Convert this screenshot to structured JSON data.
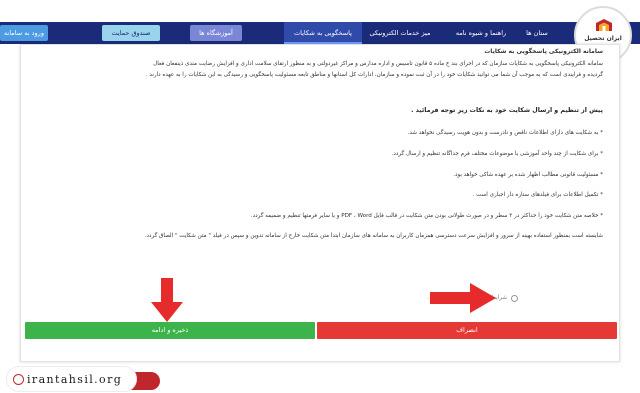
{
  "nav": {
    "items": [
      {
        "label": "ستان ها"
      },
      {
        "label": "راهنما و شیوه نامه"
      },
      {
        "label": "میز خدمات الکترونیکی"
      },
      {
        "label": "پاسخگویی به شکایات"
      }
    ],
    "buttons": {
      "training": "آموزشگاه ها",
      "support_fund": "صندوق حمایت",
      "login": "ورود به سامانه"
    }
  },
  "logo": {
    "text": "ایران تحصیل"
  },
  "content": {
    "title": "سامانه الکترونیکی پاسخگویی به شکایات",
    "intro_line1": "سامانه الکترونیکی پاسخگویی به شکایات سازمان که در اجرای بند خ ماده ۵ قانون تاسیس و اداره مدارس و مراکز غیردولتی و به منظور ارتقای سلامت اداری و افزایش رضایت مندی ذینفعان فعال",
    "intro_line2": "گردیده و فرایندی است که به موجب آن شما می توانید شکایات خود را در آن ثبت نموده و سازمان، ادارات کل استانها و مناطق تابعه مسئولیت پاسخگویی و رسیدگی به این شکایات را به عهده دارند .",
    "heading": "پیش از تنظیم و ارسال شکایت خود به نکات زیر توجه فرمائید .",
    "notes": [
      "* به شکایت های دارای اطلاعات ناقص و نادرست و بدون هویت رسیدگی نخواهد شد.",
      "* برای شکایت از چند واحد آموزشی یا موضوعات مختلف فرم جداگانه تنظیم و ارسال گردد.",
      "* مسئولیت قانونی مطالب اظهار شده بر عهده شاکی خواهد بود.",
      "* تکمیل اطلاعات برای فیلدهای ستاره دار اجباری است .",
      "* خلاصه متن شکایت خود را حداکثر در ۳ سطر و در صورت طولانی بودن متن شکایت در قالب فایل PDF ، Word و یا سایر فرمتها تنظیم و ضمیمه گردد.",
      "شایسته است بمنظور استفاده بهینه از سرور و افزایش سرعت دسترسی همزمان کاربران به سامانه های سازمان ابتدا متن شکایت خارج از سامانه تدوین و سپس در فیلد \" متن شکایت \" الصاق گردد."
    ],
    "agreement_label": "شرایط و راهنما را مطالعه نمودم ."
  },
  "actions": {
    "cancel_label": "انصراف",
    "save_label": "ذخیره و ادامه"
  },
  "footer": {
    "url": "irantahsil.org"
  },
  "colors": {
    "nav_bg": "#1a2b7a",
    "green": "#3cb44b",
    "red": "#e53935",
    "arrow_red": "#e52b2b",
    "brand_red": "#c0272d"
  },
  "icons": [
    "globe-icon",
    "arrow-down-icon",
    "arrow-right-icon",
    "logo-emblem-icon"
  ]
}
